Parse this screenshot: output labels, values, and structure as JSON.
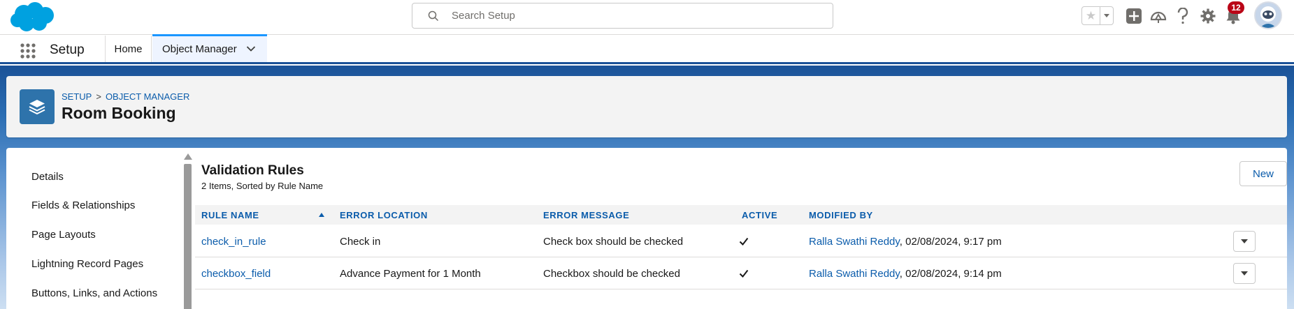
{
  "header": {
    "search_placeholder": "Search Setup",
    "notification_count": "12"
  },
  "context_bar": {
    "app_name": "Setup",
    "tabs": [
      {
        "label": "Home"
      },
      {
        "label": "Object Manager"
      }
    ]
  },
  "object_header": {
    "breadcrumb": [
      "SETUP",
      "OBJECT MANAGER"
    ],
    "breadcrumb_separator": ">",
    "title": "Room Booking"
  },
  "sidebar": {
    "items": [
      {
        "label": "Details"
      },
      {
        "label": "Fields & Relationships"
      },
      {
        "label": "Page Layouts"
      },
      {
        "label": "Lightning Record Pages"
      },
      {
        "label": "Buttons, Links, and Actions"
      }
    ]
  },
  "main": {
    "title": "Validation Rules",
    "subtitle": "2 Items, Sorted by Rule Name",
    "new_button": "New",
    "columns": [
      "RULE NAME",
      "ERROR LOCATION",
      "ERROR MESSAGE",
      "ACTIVE",
      "MODIFIED BY"
    ],
    "rows": [
      {
        "rule_name": "check_in_rule",
        "error_location": "Check in",
        "error_message": "Check box should be checked",
        "active": true,
        "modified_by": "Ralla Swathi Reddy",
        "modified_date": ", 02/08/2024, 9:17 pm"
      },
      {
        "rule_name": "checkbox_field",
        "error_location": "Advance Payment for 1 Month",
        "error_message": "Checkbox should be checked",
        "active": true,
        "modified_by": "Ralla Swathi Reddy",
        "modified_date": ", 02/08/2024, 9:14 pm"
      }
    ]
  },
  "colors": {
    "brand_blue": "#0b5cab",
    "salesforce_cloud": "#00a1e0",
    "object_icon": "#2e73ab",
    "badge_red": "#ba0517"
  }
}
